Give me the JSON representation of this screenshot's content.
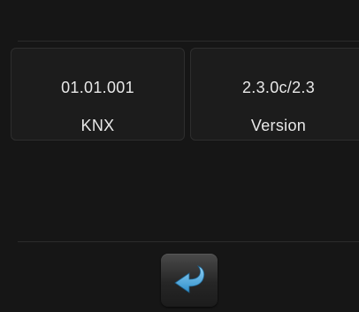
{
  "info_cards": [
    {
      "value": "01.01.001",
      "label": "KNX"
    },
    {
      "value": "2.3.0c/2.3",
      "label": "Version"
    }
  ],
  "back_button": {
    "icon": "return-arrow-icon"
  },
  "colors": {
    "background": "#161616",
    "card_background": "#1c1c1c",
    "text": "#e8e8e8",
    "accent_arrow": "#4aa8dd"
  }
}
